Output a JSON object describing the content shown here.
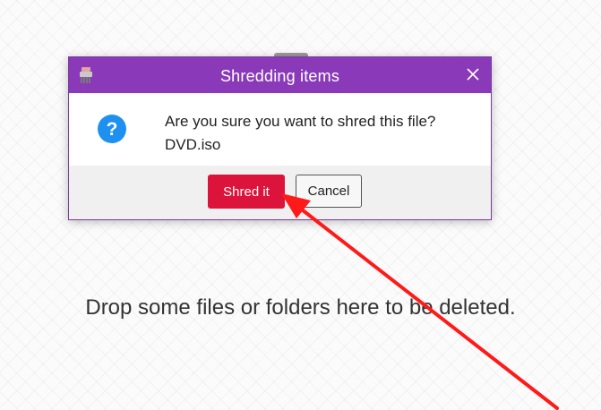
{
  "window": {
    "drop_hint": "Drop some files or folders here to be deleted."
  },
  "dialog": {
    "title": "Shredding items",
    "title_icon": "shredder-icon",
    "close_icon": "close-icon",
    "message_icon": "question-icon",
    "message_line1": "Are you sure you want to shred this file?",
    "message_line2": "DVD.iso",
    "confirm_label": "Shred it",
    "cancel_label": "Cancel"
  },
  "annotation": {
    "arrow_icon": "red-arrow-annotation",
    "color": "#ff1a1a"
  },
  "colors": {
    "titlebar": "#8a3ab9",
    "confirm_button": "#dc143c",
    "question_icon": "#1e90f0"
  }
}
